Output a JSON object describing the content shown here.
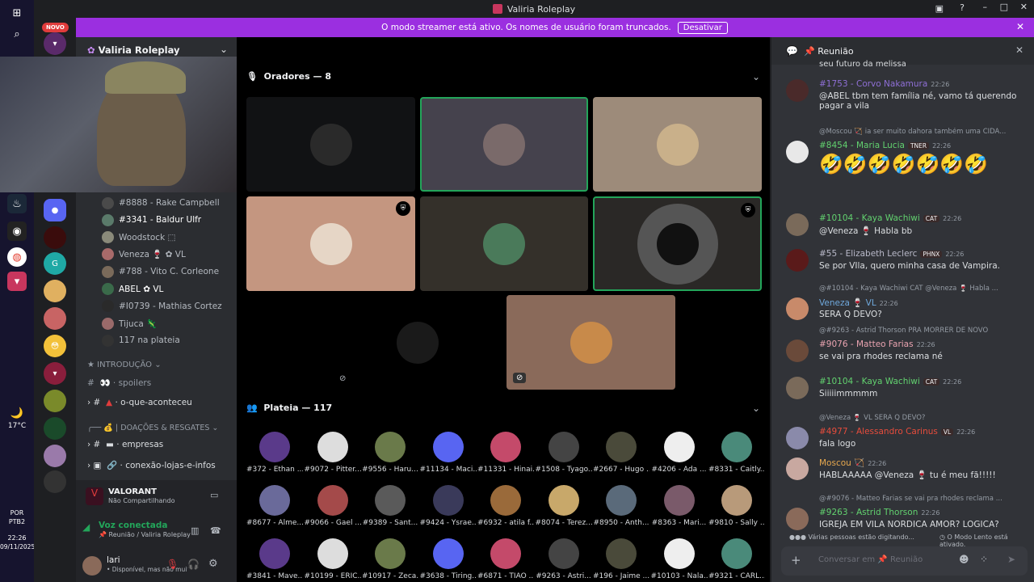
{
  "window": {
    "title": "Valiria Roleplay"
  },
  "badge_new": "NOVO",
  "streamer": {
    "text": "O modo streamer está ativo. Os nomes de usuário foram truncados.",
    "button": "Desativar"
  },
  "server": {
    "name": "Valiria Roleplay"
  },
  "voice_users": [
    {
      "name": "#8888 - Rake Campbell",
      "extra": "ZAO",
      "color": "#b5bac1"
    },
    {
      "name": "#3341 - Baldur Ulfr",
      "extra": "",
      "color": "#ffffff"
    },
    {
      "name": "Woodstock ⬚",
      "extra": "",
      "color": "#b5bac1"
    },
    {
      "name": "Veneza 🍷 ✿ VL",
      "extra": "",
      "color": "#b5bac1"
    },
    {
      "name": "#788 - Vito C. Corleone",
      "extra": "",
      "color": "#b5bac1"
    },
    {
      "name": "ABEL ✿ VL",
      "extra": "",
      "color": "#ffffff"
    },
    {
      "name": "#I0739 - Mathias Cortez",
      "extra": "",
      "color": "#b5bac1"
    },
    {
      "name": "Tijuca 🦎",
      "extra": "",
      "color": "#b5bac1"
    },
    {
      "name": "117 na plateia",
      "extra": "",
      "color": "#b5bac1"
    }
  ],
  "categories": {
    "intro": "INTRODUÇÃO",
    "doacoes": "| DOAÇÕES & RESGATES"
  },
  "channel_list": {
    "spoilers": "👀 · spoilers",
    "acontece": "· o-que-aconteceu",
    "empresas": "· empresas",
    "conexao": "· conexão-lojas-e-infos"
  },
  "activity": {
    "game": "VALORANT",
    "sub": "Não Compartilhando"
  },
  "voice": {
    "status": "Voz conectada",
    "channel": "📌 Reunião / Valiria Roleplay"
  },
  "user": {
    "name": "lari",
    "status": "• Disponível, mas não muit..."
  },
  "weather": {
    "temp": "17°C"
  },
  "clock": {
    "lang": "POR",
    "layout": "PTB2",
    "time": "22:26",
    "date": "09/11/2025"
  },
  "stage": {
    "speakers_label": "Oradores — 8",
    "audience_label": "Plateia — 117"
  },
  "audience": [
    [
      "#372 - Ethan ...",
      "#9072 - Pitter...",
      "#9556 - Haru...",
      "#11134 - Maci...",
      "#11331 - Hinai...",
      "#1508 - Tyago...",
      "#2667 - Hugo ...",
      "#4206 - Ada ...",
      "#8331 - Caitly..."
    ],
    [
      "#8677 - Alme...",
      "#9066 - Gael ...",
      "#9389 - Sant...",
      "#9424 - Ysrae...",
      "#6932 - atila f...",
      "#8074 - Terez...",
      "#8950 - Anth...",
      "#8363 - Mari...",
      "#9810 - Sally ..."
    ],
    [
      "#3841 - Mave...",
      "#10199 - ERIC...",
      "#10917 - Zeca...",
      "#3638 - Tiring...",
      "#6871 - TIAO ...",
      "#9263 - Astri...",
      "#196 - Jaime ...",
      "#10103 - Nala...",
      "#9321 - CARL..."
    ]
  ],
  "chat": {
    "channel": "📌 Reunião",
    "top_text": "seu futuro da melissa",
    "messages": [
      {
        "name": "#1753 - Corvo Nakamura",
        "time": "22:26",
        "text": "@ABEL tbm tem família né, vamo tá querendo pagar a vila",
        "color": "#8f6fd6"
      },
      {
        "reply": "@Moscou 🏹 ia ser muito dahora também uma CIDA...",
        "name": "#8454 - Maria  Lucia",
        "tag": "TNER",
        "time": "22:26",
        "text": "🤣🤣🤣🤣🤣🤣🤣",
        "color": "#62d26f"
      },
      {
        "name": "#10104 - Kaya Wachiwi",
        "tag": "CAT",
        "time": "22:26",
        "text": "@Veneza 🍷 Habla bb",
        "color": "#62d26f"
      },
      {
        "name": "#55 - Elizabeth Leclerc",
        "tag": "PHNX",
        "time": "22:26",
        "text": "Se por VIla, quero minha casa de Vampira.",
        "color": "#b9b9c9"
      },
      {
        "reply": "@#10104 - Kaya Wachiwi CAT @Veneza 🍷 Habla ...",
        "name": "Veneza 🍷 VL",
        "time": "22:26",
        "text": "SERA Q DEVO?",
        "color": "#6fa8dc"
      },
      {
        "reply": "@#9263 - Astrid Thorson PRA MORRER DE NOVO",
        "name": "#9076 - Matteo Farias",
        "time": "22:26",
        "text": "se vai pra rhodes reclama né",
        "color": "#e9a3b0"
      },
      {
        "name": "#10104 - Kaya Wachiwi",
        "tag": "CAT",
        "time": "22:26",
        "text": "Siiiiimmmmm",
        "color": "#62d26f"
      },
      {
        "reply": "@Veneza 🍷 VL SERA Q DEVO?",
        "name": "#4977 - Alessandro Carinus",
        "tag": "VL",
        "time": "22:26",
        "text": "fala logo",
        "color": "#e74c3c"
      },
      {
        "name": "Moscou 🏹",
        "time": "22:26",
        "text": "HABLAAAAA @Veneza 🍷 tu é meu fã!!!!!",
        "color": "#e6a84f"
      },
      {
        "reply": "@#9076 - Matteo Farias se vai pra rhodes reclama ...",
        "name": "#9263 - Astrid Thorson",
        "time": "22:26",
        "text": "IGREJA EM VILA NORDICA AMOR? LOGICA?",
        "color": "#62d26f"
      }
    ],
    "typing": "Várias pessoas estão digitando...",
    "slowmode": "O Modo Lento está ativado.",
    "input_placeholder": "Conversar em 📌 Reunião"
  }
}
